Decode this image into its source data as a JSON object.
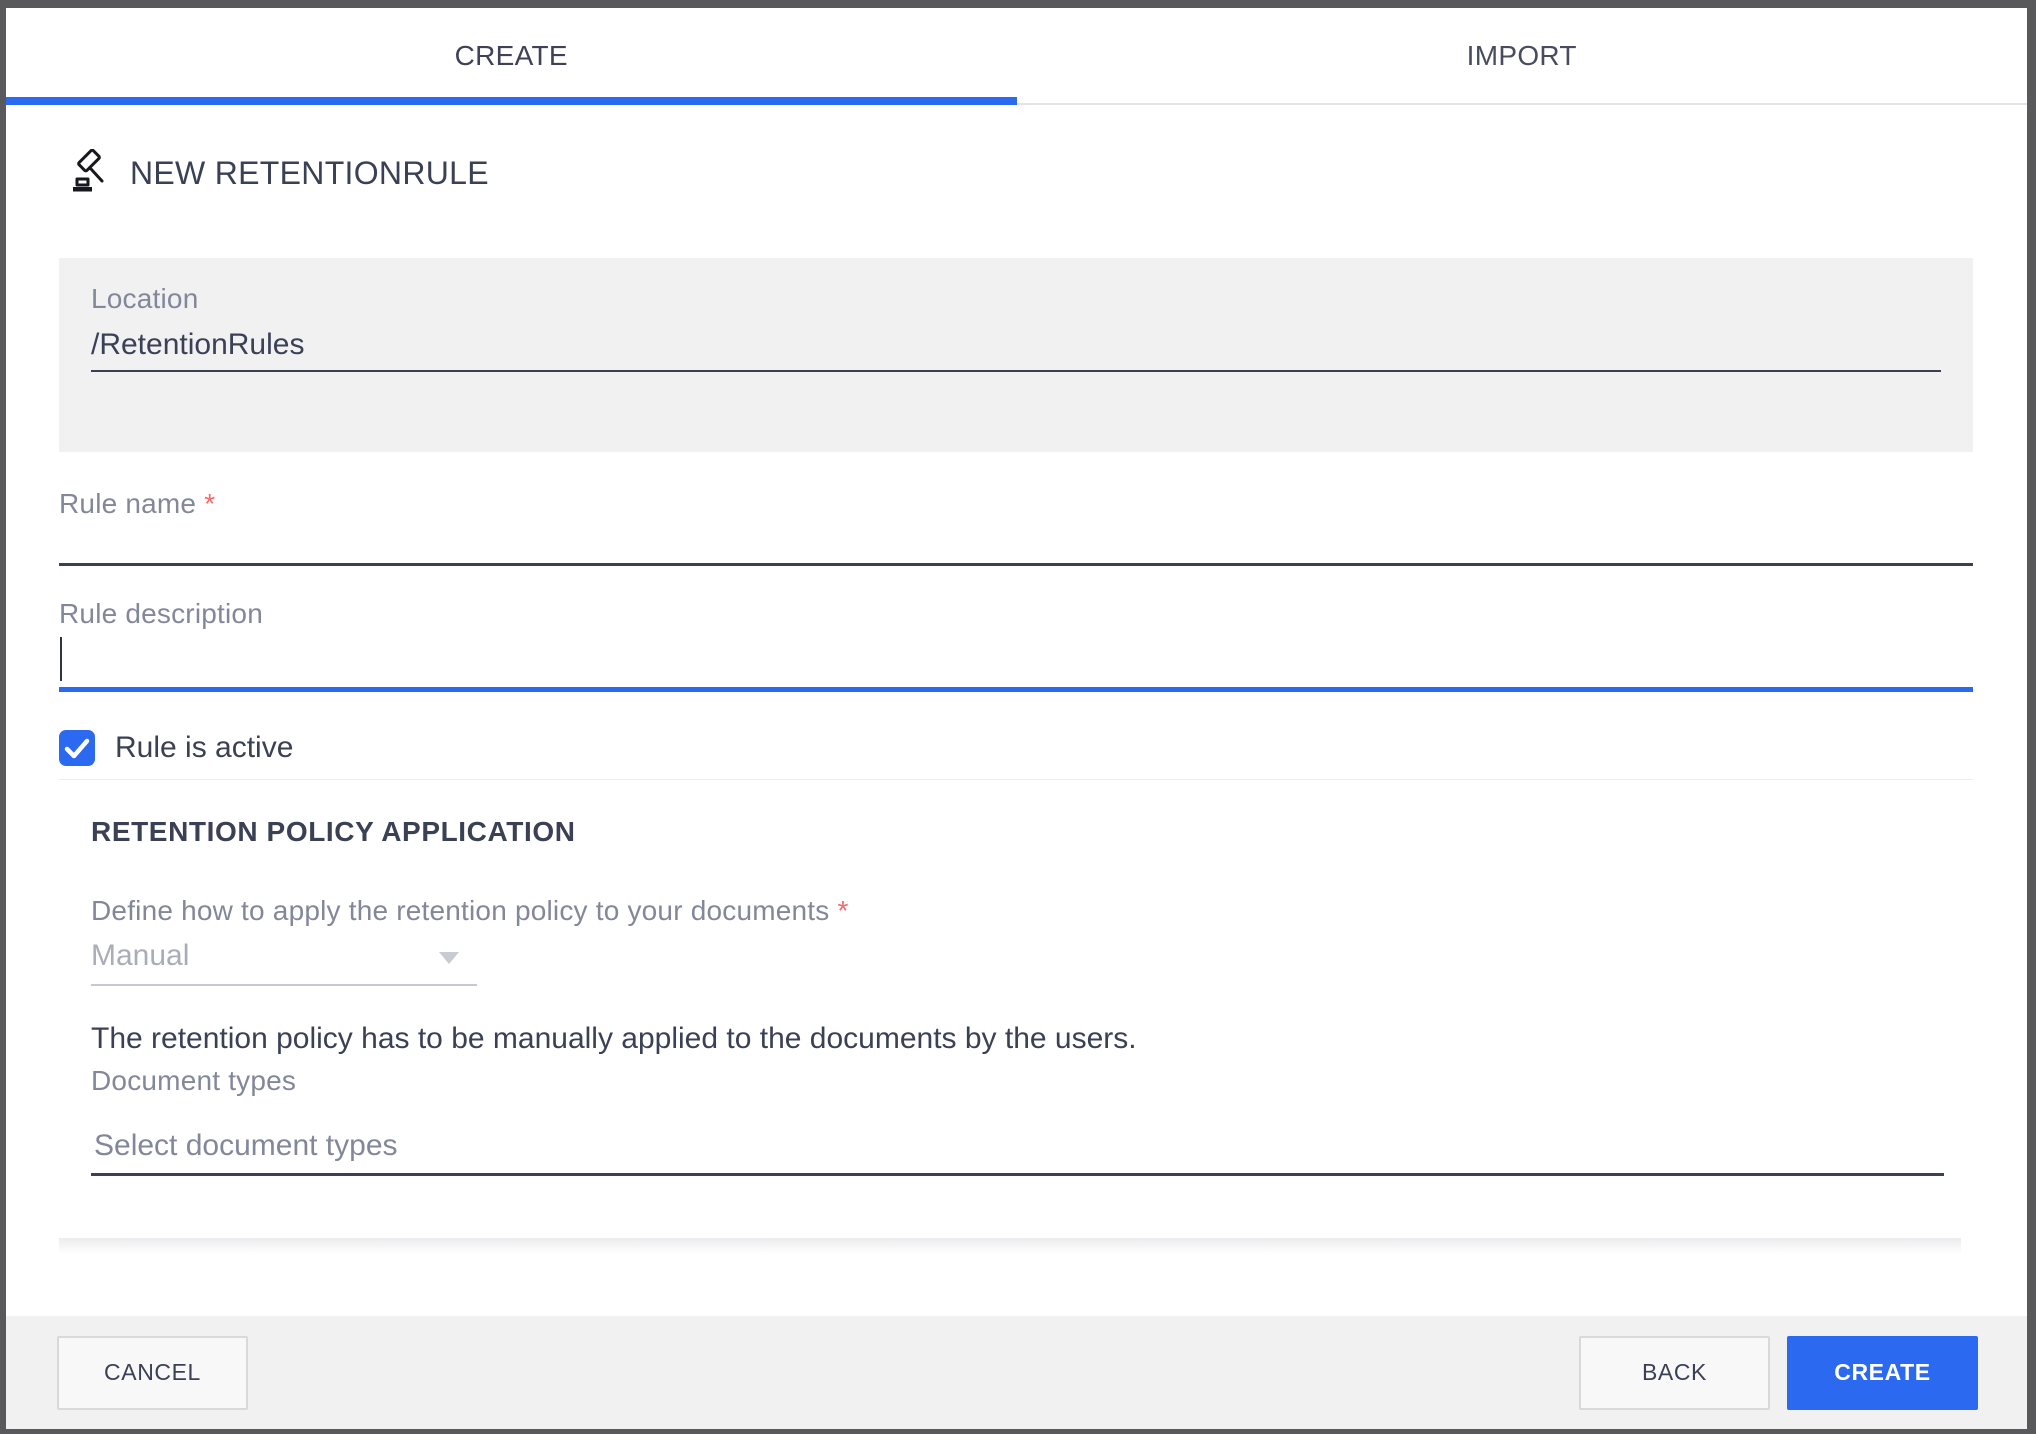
{
  "tabs": {
    "create": {
      "label": "CREATE",
      "active": true
    },
    "import": {
      "label": "IMPORT",
      "active": false
    }
  },
  "header": {
    "title": "NEW RETENTIONRULE",
    "icon": "gavel-icon"
  },
  "form": {
    "location": {
      "label": "Location",
      "value": "/RetentionRules"
    },
    "rule_name": {
      "label": "Rule name",
      "required_marker": "*",
      "value": ""
    },
    "rule_description": {
      "label": "Rule description",
      "value": "",
      "focused": true
    },
    "rule_active": {
      "label": "Rule is active",
      "checked": true,
      "icon": "check-icon"
    },
    "retention_section": {
      "title": "RETENTION POLICY APPLICATION",
      "apply_mode": {
        "label": "Define how to apply the retention policy to your documents",
        "required_marker": "*",
        "value": "Manual",
        "icon": "chevron-down-icon",
        "disabled": true
      },
      "apply_mode_help": "The retention policy has to be manually applied to the documents by the users.",
      "document_types": {
        "label": "Document types",
        "placeholder": "Select document types",
        "value": ""
      }
    }
  },
  "footer": {
    "cancel_label": "CANCEL",
    "back_label": "BACK",
    "create_label": "CREATE"
  },
  "colors": {
    "accent": "#2b69f1",
    "text": "#3b4155",
    "label": "#83879a",
    "required": "#f4696b",
    "panel_bg": "#f1f1f2",
    "window_border": "#59595b"
  }
}
